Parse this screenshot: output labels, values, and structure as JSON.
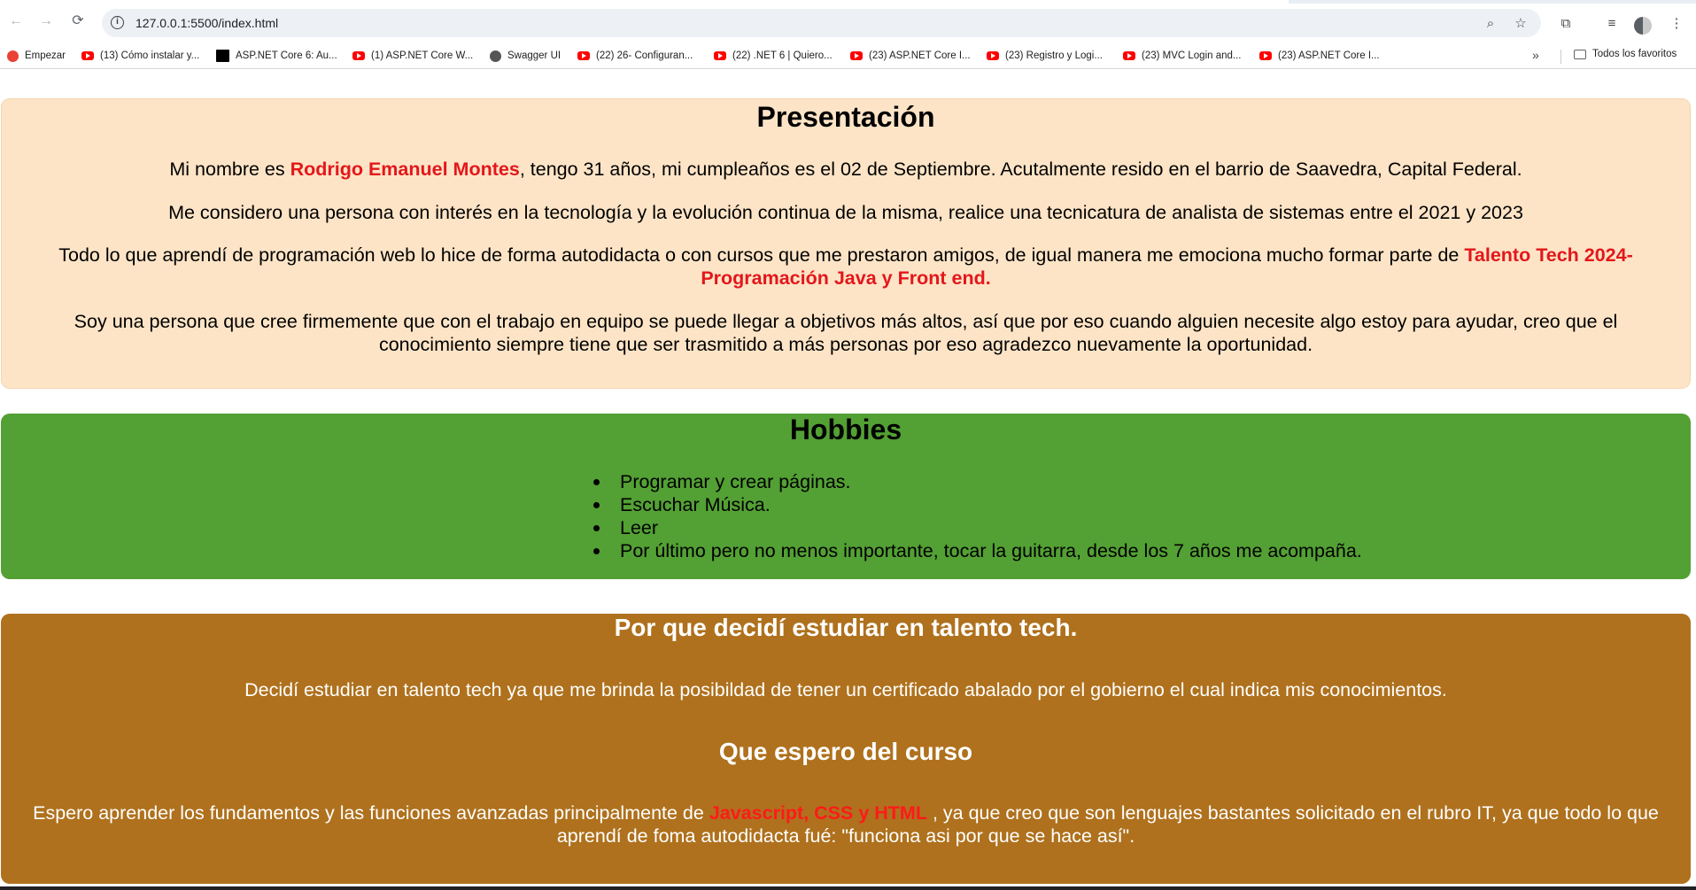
{
  "browser": {
    "url": "127.0.0.1:5500/index.html",
    "bookmarks": [
      {
        "label": "Empezar",
        "icon": "start-icon"
      },
      {
        "label": "(13) Cómo instalar y...",
        "icon": "youtube-icon"
      },
      {
        "label": "ASP.NET Core 6: Au...",
        "icon": "dev-icon"
      },
      {
        "label": "(1) ASP.NET Core W...",
        "icon": "youtube-icon"
      },
      {
        "label": "Swagger UI",
        "icon": "swagger-icon"
      },
      {
        "label": "(22) 26- Configuran...",
        "icon": "youtube-icon"
      },
      {
        "label": "(22) .NET 6 | Quiero...",
        "icon": "youtube-icon"
      },
      {
        "label": "(23) ASP.NET Core I...",
        "icon": "youtube-icon"
      },
      {
        "label": "(23) Registro y Logi...",
        "icon": "youtube-icon"
      },
      {
        "label": "(23) MVC Login and...",
        "icon": "youtube-icon"
      },
      {
        "label": "(23) ASP.NET Core I...",
        "icon": "youtube-icon"
      }
    ],
    "bookmarks_more": "»",
    "all_bookmarks": "Todos los favoritos"
  },
  "presentacion": {
    "title": "Presentación",
    "p1_a": "Mi nombre es ",
    "p1_name": "Rodrigo Emanuel Montes",
    "p1_b": ", tengo 31 años, mi cumpleaños es el 02 de Septiembre. Acutalmente resido en el barrio de Saavedra, Capital Federal.",
    "p2": "Me considero una persona con interés en la tecnología y la evolución continua de la misma, realice una tecnicatura de analista de sistemas entre el 2021 y 2023",
    "p3_a": "Todo lo que aprendí de programación web lo hice de forma autodidacta o con cursos que me prestaron amigos, de igual manera me emociona mucho formar parte de ",
    "p3_hl": "Talento Tech 2024- Programación Java y Front end.",
    "p4": "Soy una persona que cree firmemente que con el trabajo en equipo se puede llegar a objetivos más altos, así que por eso cuando alguien necesite algo estoy para ayudar, creo que el conocimiento siempre tiene que ser trasmitido a más personas por eso agradezco nuevamente la oportunidad."
  },
  "hobbies": {
    "title": "Hobbies",
    "items": [
      "Programar y crear páginas.",
      "Escuchar Música.",
      "Leer",
      "Por último pero no menos importante, tocar la guitarra, desde los 7 años me acompaña."
    ]
  },
  "talento": {
    "title": "Por que decidí estudiar en talento tech.",
    "p1": "Decidí estudiar en talento tech ya que me brinda la posibildad de tener un certificado abalado por el gobierno el cual indica mis conocimientos.",
    "subtitle": "Que espero del curso",
    "p2_a": "Espero aprender los fundamentos y las funciones avanzadas principalmente de ",
    "p2_hl": "Javascript, CSS y HTML",
    "p2_b": " , ya que creo que son lenguajes bastantes solicitado en el rubro IT, ya que todo lo que aprendí de foma autodidacta fué: \"funciona asi por que se hace así\"."
  },
  "colors": {
    "presentacion_bg": "#fde4c6",
    "hobbies_bg": "#53a034",
    "talento_bg": "#af711d",
    "highlight": "#e3171b"
  }
}
